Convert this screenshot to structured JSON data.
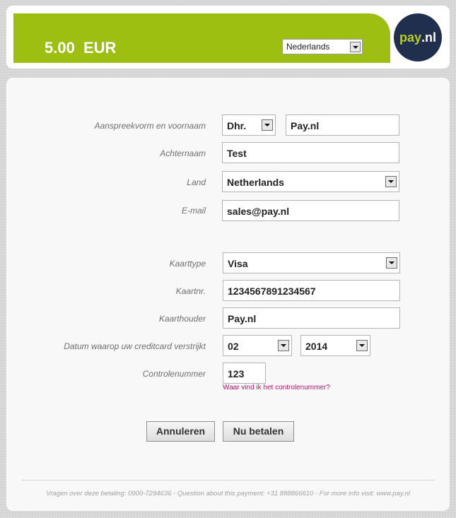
{
  "header": {
    "amount": "5.00",
    "currency": "EUR",
    "language_selected": "Nederlands",
    "logo_part1": "pay",
    "logo_part2": ".nl"
  },
  "form": {
    "salutation_label": "Aanspreekvorm en voornaam",
    "salutation_value": "Dhr.",
    "firstname_value": "Pay.nl",
    "lastname_label": "Achternaam",
    "lastname_value": "Test",
    "country_label": "Land",
    "country_value": "Netherlands",
    "email_label": "E-mail",
    "email_value": "sales@pay.nl",
    "cardtype_label": "Kaarttype",
    "cardtype_value": "Visa",
    "cardnumber_label": "Kaartnr.",
    "cardnumber_value": "1234567891234567",
    "cardholder_label": "Kaarthouder",
    "cardholder_value": "Pay.nl",
    "expiry_label": "Datum waarop uw creditcard verstrijkt",
    "expiry_month": "02",
    "expiry_year": "2014",
    "cvc_label": "Controlenummer",
    "cvc_value": "123",
    "cvc_help": "Waar vind ik het controlenummer?"
  },
  "buttons": {
    "cancel": "Annuleren",
    "pay": "Nu betalen"
  },
  "footer": {
    "text": "Vragen over deze betaling: 0900-7294636 - Question about this payment: +31 888866610 - For more info visit: www.pay.nl"
  },
  "colors": {
    "brand_green": "#9cbf11",
    "logo_navy": "#1f2f4d",
    "link_magenta": "#c0166c"
  }
}
